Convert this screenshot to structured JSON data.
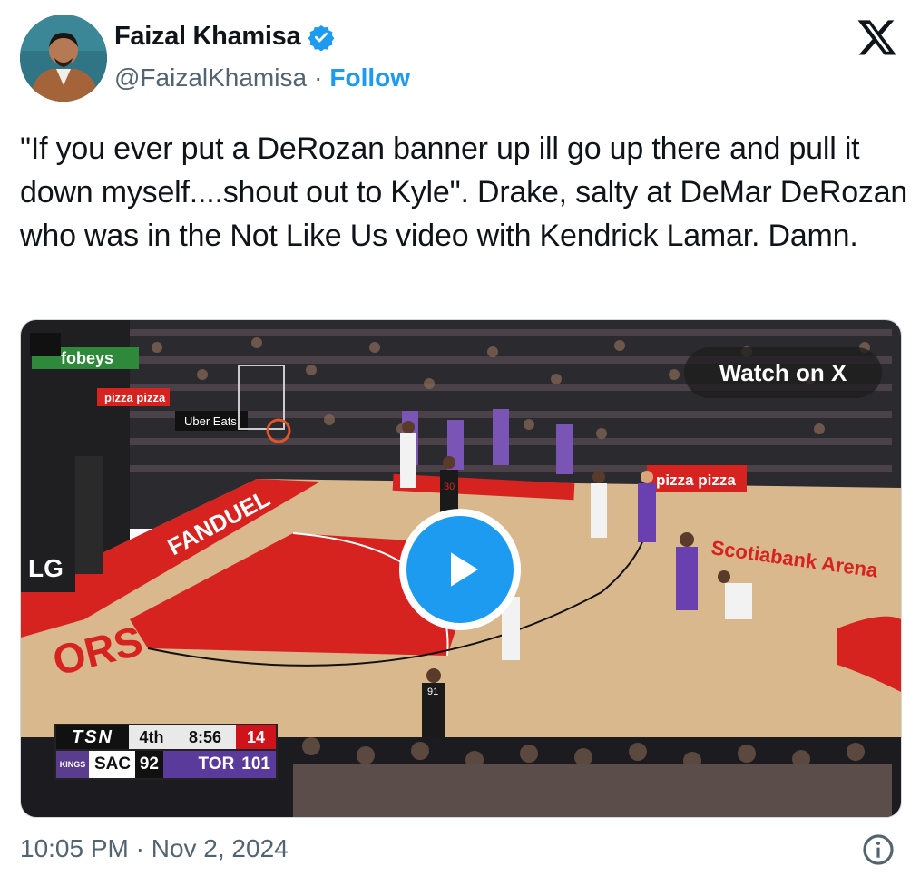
{
  "author": {
    "name": "Faizal Khamisa",
    "handle": "@FaizalKhamisa",
    "separator": "·",
    "follow_label": "Follow",
    "verified": true
  },
  "tweet": {
    "text": "\"If you ever put a DeRozan banner up ill go up there and pull it down myself....shout out to Kyle\". Drake, salty at DeMar DeRozan who was in the Not Like Us video with Kendrick Lamar. Damn."
  },
  "media": {
    "watch_label": "Watch on X",
    "court_signage": {
      "sponsor_1": "fobeys",
      "sponsor_2": "Uber Eats",
      "sponsor_3": "pizza pizza",
      "sponsor_4": "FANDUEL",
      "sponsor_5": "LG",
      "arena": "Scotiabank Arena",
      "baseline": "ORS",
      "referee_number": "91",
      "player_number": "30"
    },
    "scorebug": {
      "network": "TSN",
      "period": "4th",
      "clock": "8:56",
      "shot_clock": "14",
      "home": {
        "abbr": "TOR",
        "score": "101"
      },
      "away": {
        "abbr": "SAC",
        "score": "92",
        "logo_text": "KINGS"
      }
    }
  },
  "footer": {
    "timestamp": "10:05 PM · Nov 2, 2024"
  },
  "colors": {
    "accent": "#1d9bf0",
    "text": "#0f1419",
    "muted": "#536471",
    "court_red": "#d6231f"
  }
}
